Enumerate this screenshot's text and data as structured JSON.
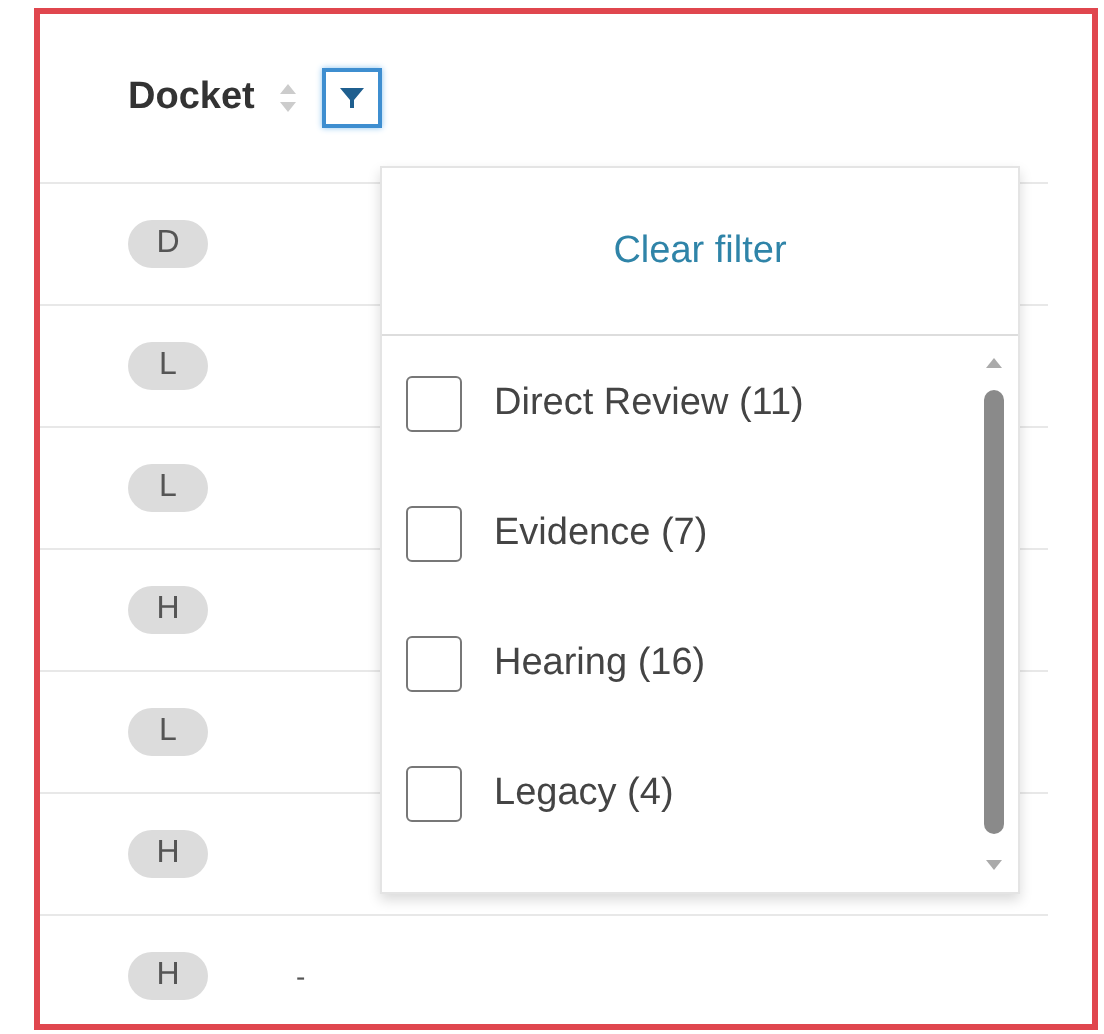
{
  "column": {
    "label": "Docket"
  },
  "rows": [
    {
      "badge": "D"
    },
    {
      "badge": "L"
    },
    {
      "badge": "L"
    },
    {
      "badge": "H"
    },
    {
      "badge": "L"
    },
    {
      "badge": "H"
    },
    {
      "badge": "H",
      "column_2": "-"
    }
  ],
  "filter_menu": {
    "clear_label": "Clear filter",
    "options": [
      {
        "label": "Direct Review (11)",
        "checked": false
      },
      {
        "label": "Evidence (7)",
        "checked": false
      },
      {
        "label": "Hearing (16)",
        "checked": false
      },
      {
        "label": "Legacy (4)",
        "checked": false
      }
    ]
  }
}
